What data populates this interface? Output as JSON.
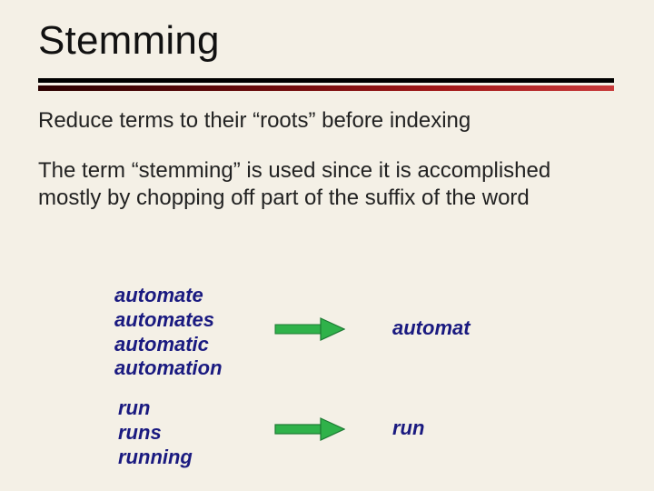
{
  "title": "Stemming",
  "paragraph1": "Reduce terms to their “roots” before indexing",
  "paragraph2": "The term “stemming” is used since it is accomplished mostly by chopping off part of the suffix of the word",
  "examples": [
    {
      "inputs": [
        "automate",
        "automates",
        "automatic",
        "automation"
      ],
      "output": "automat"
    },
    {
      "inputs": [
        "run",
        "runs",
        "running"
      ],
      "output": "run"
    }
  ],
  "colors": {
    "emphasis": "#1a1a80",
    "arrow_fill": "#2fb24a",
    "arrow_stroke": "#1d7a33"
  }
}
